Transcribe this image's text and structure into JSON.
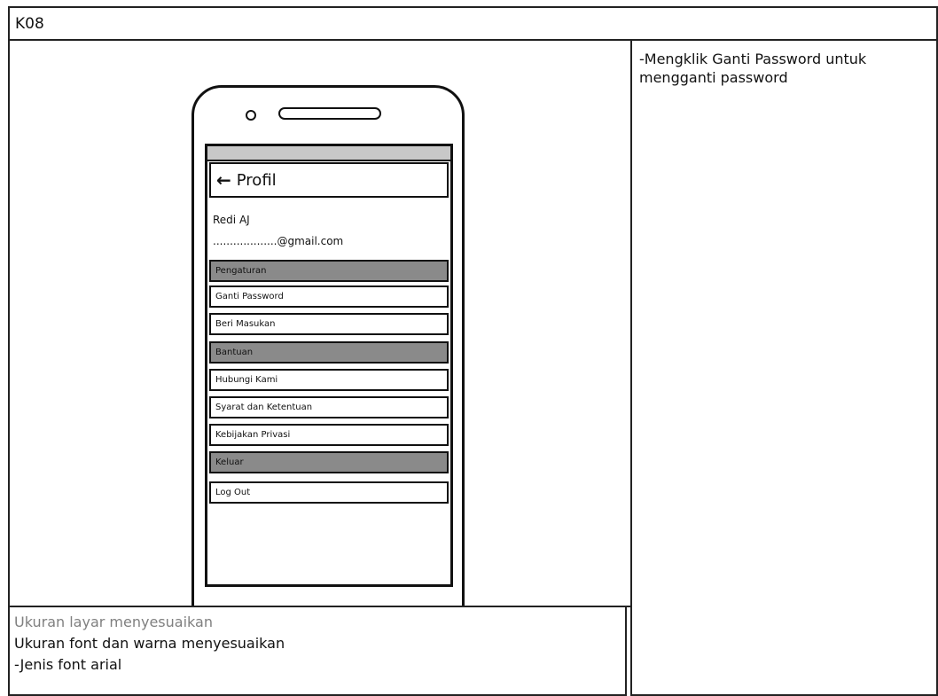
{
  "window": {
    "title": "K08"
  },
  "right_note": "-Mengklik Ganti Password untuk mengganti password",
  "bottom_notes": {
    "line1": "Ukuran layar menyesuaikan",
    "line2": "Ukuran font dan warna menyesuaikan",
    "line3": "-Jenis font arial"
  },
  "phone": {
    "header": {
      "back_icon": "arrow-left-icon",
      "title": "Profil"
    },
    "user": {
      "name": "Redi AJ",
      "email": "...................@gmail.com"
    },
    "sections": [
      {
        "label": "Pengaturan",
        "kind": "header"
      },
      {
        "label": "Ganti Password",
        "kind": "item"
      },
      {
        "label": "Beri Masukan",
        "kind": "item"
      },
      {
        "label": "Bantuan",
        "kind": "header"
      },
      {
        "label": "Hubungi Kami",
        "kind": "item"
      },
      {
        "label": "Syarat dan Ketentuan",
        "kind": "item"
      },
      {
        "label": "Kebijakan Privasi",
        "kind": "item"
      },
      {
        "label": "Keluar",
        "kind": "header"
      },
      {
        "label": "Log Out",
        "kind": "item"
      }
    ]
  },
  "colors": {
    "section_header_bg": "#8a8a8a",
    "status_strip": "#c8c8c8",
    "muted_text": "#808080"
  }
}
